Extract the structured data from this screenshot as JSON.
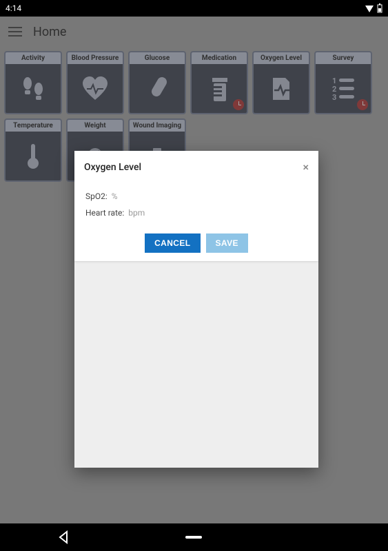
{
  "status": {
    "time": "4:14"
  },
  "appbar": {
    "title": "Home"
  },
  "tiles": [
    {
      "label": "Activity",
      "icon": "footsteps",
      "badge": false
    },
    {
      "label": "Blood Pressure",
      "icon": "heart-pulse",
      "badge": false
    },
    {
      "label": "Glucose",
      "icon": "tube",
      "badge": false
    },
    {
      "label": "Medication",
      "icon": "pill-bottle",
      "badge": true
    },
    {
      "label": "Oxygen Level",
      "icon": "pulse-doc",
      "badge": false
    },
    {
      "label": "Survey",
      "icon": "survey",
      "badge": true
    },
    {
      "label": "Temperature",
      "icon": "thermometer",
      "badge": false
    },
    {
      "label": "Weight",
      "icon": "scale",
      "badge": false
    },
    {
      "label": "Wound Imaging",
      "icon": "camera",
      "badge": false
    }
  ],
  "dialog": {
    "title": "Oxygen Level",
    "fields": {
      "spo2": {
        "label": "SpO2:",
        "unit": "%"
      },
      "heartrate": {
        "label": "Heart rate:",
        "unit": "bpm"
      }
    },
    "actions": {
      "cancel": "CANCEL",
      "save": "SAVE"
    }
  }
}
